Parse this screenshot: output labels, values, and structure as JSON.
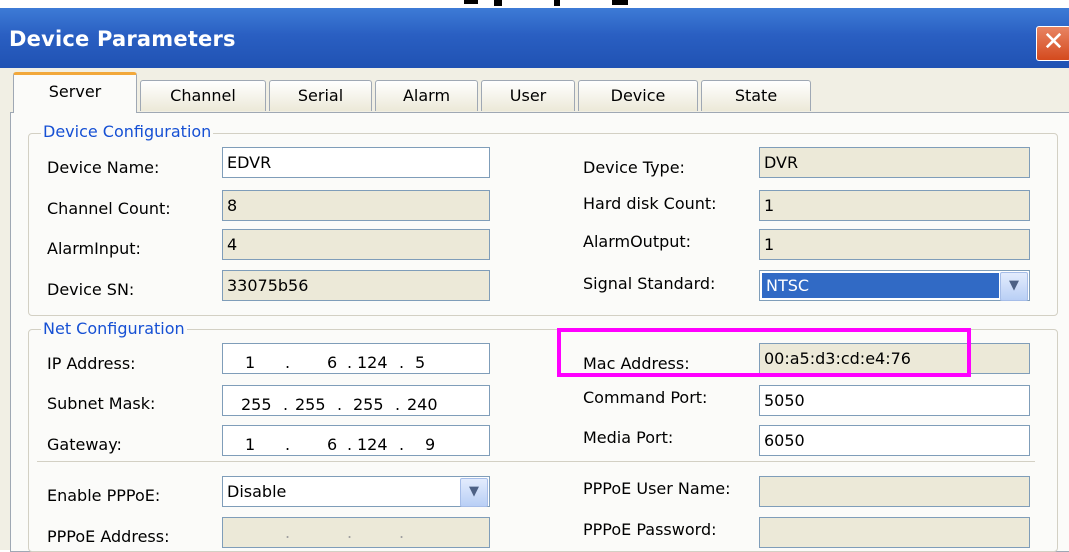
{
  "window": {
    "title": "Device Parameters",
    "close_icon": "close-icon"
  },
  "tabs": [
    {
      "label": "Server",
      "active": true
    },
    {
      "label": "Channel"
    },
    {
      "label": "Serial"
    },
    {
      "label": "Alarm"
    },
    {
      "label": "User"
    },
    {
      "label": "Device"
    },
    {
      "label": "State"
    }
  ],
  "device_config": {
    "group_label": "Device Configuration",
    "device_name": {
      "label": "Device Name:",
      "value": "EDVR"
    },
    "channel_count": {
      "label": "Channel Count:",
      "value": "8"
    },
    "alarm_input": {
      "label": "AlarmInput:",
      "value": "4"
    },
    "device_sn": {
      "label": "Device SN:",
      "value": "33075b56"
    },
    "device_type": {
      "label": "Device Type:",
      "value": "DVR"
    },
    "hard_disk_count": {
      "label": "Hard disk Count:",
      "value": "1"
    },
    "alarm_output": {
      "label": "AlarmOutput:",
      "value": "1"
    },
    "signal_standard": {
      "label": "Signal Standard:",
      "value": "NTSC"
    }
  },
  "net_config": {
    "group_label": "Net Configuration",
    "ip_address": {
      "label": "IP Address:",
      "octets": [
        "1",
        "6",
        "124",
        "5"
      ]
    },
    "subnet_mask": {
      "label": "Subnet Mask:",
      "octets": [
        "255",
        "255",
        "255",
        "240"
      ]
    },
    "gateway": {
      "label": "Gateway:",
      "octets": [
        "1",
        "6",
        "124",
        "9"
      ]
    },
    "mac_address": {
      "label": "Mac Address:",
      "value": "00:a5:d3:cd:e4:76"
    },
    "command_port": {
      "label": "Command Port:",
      "value": "5050"
    },
    "media_port": {
      "label": "Media Port:",
      "value": "6050"
    },
    "enable_pppoe": {
      "label": "Enable PPPoE:",
      "value": "Disable"
    },
    "pppoe_address": {
      "label": "PPPoE Address:",
      "value": ""
    },
    "pppoe_user_name": {
      "label": "PPPoE User Name:",
      "value": ""
    },
    "pppoe_password": {
      "label": "PPPoE Password:",
      "value": ""
    }
  },
  "colors": {
    "titlebar": "#2a5fc2",
    "group_label": "#1650d4",
    "highlight": "#ff00ff",
    "selection": "#316ac5"
  }
}
